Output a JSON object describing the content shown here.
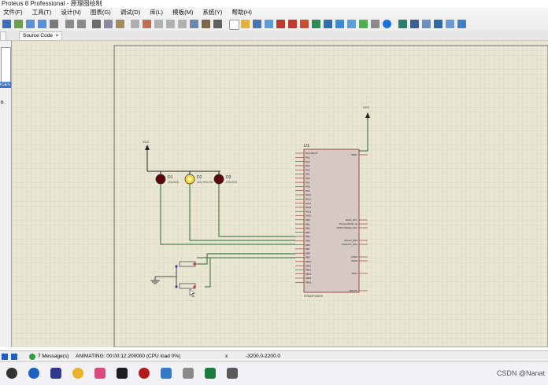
{
  "window": {
    "title": "Proteus 8 Professional - 原理图绘制"
  },
  "menu": [
    "文件(F)",
    "工具(T)",
    "设计(N)",
    "图表(G)",
    "调试(D)",
    "库(L)",
    "模板(M)",
    "系统(Y)",
    "帮助(H)"
  ],
  "tabs": [
    {
      "label": "Source Code"
    }
  ],
  "left_panel": {
    "label_top": "ICES",
    "label_b": "B"
  },
  "schematic": {
    "chip_ref": "U1",
    "chip_part": "STM32F103C8",
    "vcc_left": "VCC",
    "vcc_right": "VCC",
    "leds": [
      {
        "ref": "D1",
        "part": "LED-RED"
      },
      {
        "ref": "D2",
        "part": "LED-YELLOW"
      },
      {
        "ref": "D3",
        "part": "LED-RED"
      }
    ],
    "left_pins": [
      "PA0-WKUP",
      "PA1",
      "PA2",
      "PA3",
      "PA4",
      "PA5",
      "PA6",
      "PA7",
      "PA8",
      "PA9",
      "PA10",
      "PA11",
      "PA12",
      "PA13",
      "PA14",
      "PA15",
      "PB0",
      "PB1",
      "PB2",
      "PB3",
      "PB4",
      "PB5",
      "PB6",
      "PB7",
      "PB8",
      "PB9",
      "PB10",
      "PB11",
      "PB12",
      "PB13",
      "PB14",
      "PB15"
    ],
    "right_pins": [
      "NRST",
      "PC13_RTC",
      "PC14-OSC32_IN",
      "PC15-OSC32_OUT",
      "OSCIN_PD0",
      "OSCOUT_PD1",
      "VDDA",
      "VSSA",
      "VBAT",
      "BOOT0"
    ]
  },
  "status": {
    "messages": "7 Message(s)",
    "animating": "ANIMATING: 00:00:12.200000 (CPU load 0%)",
    "x_label": "x",
    "x_value": "-3200.0",
    "y_value": "-2200.0"
  },
  "watermark": "CSDN @Nanat"
}
